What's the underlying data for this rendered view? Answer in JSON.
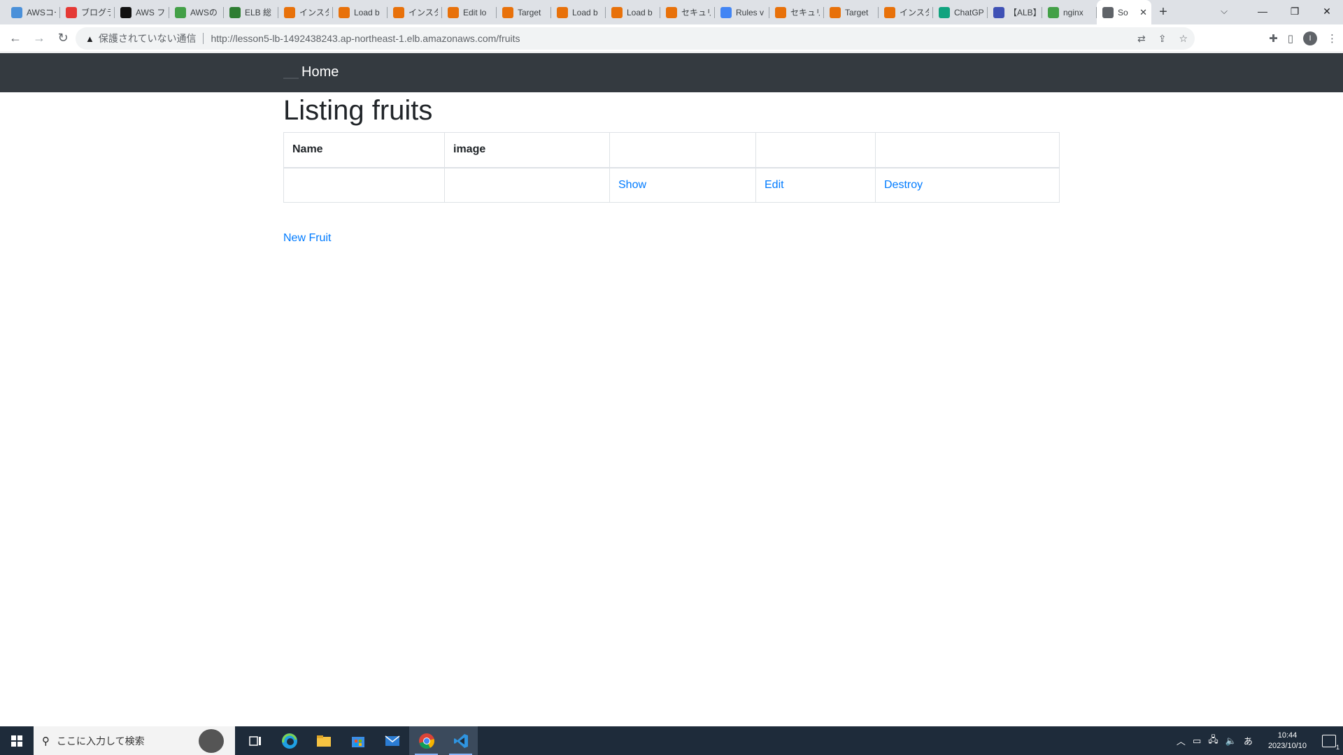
{
  "browser": {
    "tabs": [
      {
        "title": "AWSコー",
        "color": "#4a90d9"
      },
      {
        "title": "ブログラ",
        "color": "#e53935"
      },
      {
        "title": "AWS フ",
        "color": "#111111"
      },
      {
        "title": "AWSの",
        "color": "#43a047"
      },
      {
        "title": "ELB 総",
        "color": "#2e7d32"
      },
      {
        "title": "インスタ",
        "color": "#e8710a"
      },
      {
        "title": "Load b",
        "color": "#e8710a"
      },
      {
        "title": "インスタ",
        "color": "#e8710a"
      },
      {
        "title": "Edit lo",
        "color": "#e8710a"
      },
      {
        "title": "Target",
        "color": "#e8710a"
      },
      {
        "title": "Load b",
        "color": "#e8710a"
      },
      {
        "title": "Load b",
        "color": "#e8710a"
      },
      {
        "title": "セキュリ",
        "color": "#e8710a"
      },
      {
        "title": "Rules v",
        "color": "#4285f4"
      },
      {
        "title": "セキュリ",
        "color": "#e8710a"
      },
      {
        "title": "Target",
        "color": "#e8710a"
      },
      {
        "title": "インスタ",
        "color": "#e8710a"
      },
      {
        "title": "ChatGP",
        "color": "#10a37f"
      },
      {
        "title": "【ALB】",
        "color": "#3f51b5"
      },
      {
        "title": "nginx",
        "color": "#43a047"
      },
      {
        "title": "So",
        "color": "#5f6368"
      }
    ],
    "security_label": "保護されていない通信",
    "url": "http://lesson5-lb-1492438243.ap-northeast-1.elb.amazonaws.com/fruits",
    "profile_initial": "I"
  },
  "app": {
    "nav_home": "Home",
    "heading": "Listing fruits",
    "table": {
      "headers": [
        "Name",
        "image",
        "",
        "",
        ""
      ],
      "rows": [
        {
          "name": "",
          "image": "",
          "show": "Show",
          "edit": "Edit",
          "destroy": "Destroy"
        }
      ]
    },
    "new_link": "New Fruit"
  },
  "taskbar": {
    "search_placeholder": "ここに入力して検索",
    "time": "10:44",
    "date": "2023/10/10",
    "ime": "あ",
    "notification_count": "1"
  },
  "colors": {
    "navbar": "#343a40",
    "link": "#007bff",
    "taskbar": "#1e2b3a"
  }
}
